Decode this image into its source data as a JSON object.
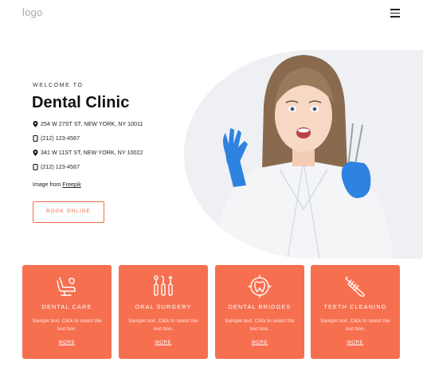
{
  "header": {
    "logo": "logo",
    "menu_icon": "hamburger-menu-icon"
  },
  "hero": {
    "eyebrow": "WELCOME TO",
    "title": "Dental Clinic",
    "contacts": [
      {
        "icon": "map-pin-icon",
        "text": "254 W 27ST ST, NEW YORK, NY 10011"
      },
      {
        "icon": "phone-icon",
        "text": "(212) 123-4567"
      },
      {
        "icon": "map-pin-icon",
        "text": "341 W 11ST ST, NEW YORK, NY 10022"
      },
      {
        "icon": "phone-icon",
        "text": "(212) 123-4567"
      }
    ],
    "credit_prefix": "Image from ",
    "credit_link": "Freepik",
    "button": "BOOK ONLINE"
  },
  "theme": {
    "accent": "#f6704f",
    "button_border": "#f26b4b"
  },
  "services": [
    {
      "icon": "dental-chair-icon",
      "title": "DENTAL CARE",
      "text": "Sample text. Click to select the text box.",
      "more": "MORE"
    },
    {
      "icon": "dental-tools-icon",
      "title": "ORAL SURGERY",
      "text": "Sample text. Click to select the text box.",
      "more": "MORE"
    },
    {
      "icon": "tooth-target-icon",
      "title": "DENTAL BRIDGES",
      "text": "Sample text. Click to select the text box.",
      "more": "MORE"
    },
    {
      "icon": "toothbrush-icon",
      "title": "TEETH CLEANING",
      "text": "Sample text. Click to select the text box.",
      "more": "MORE"
    }
  ]
}
